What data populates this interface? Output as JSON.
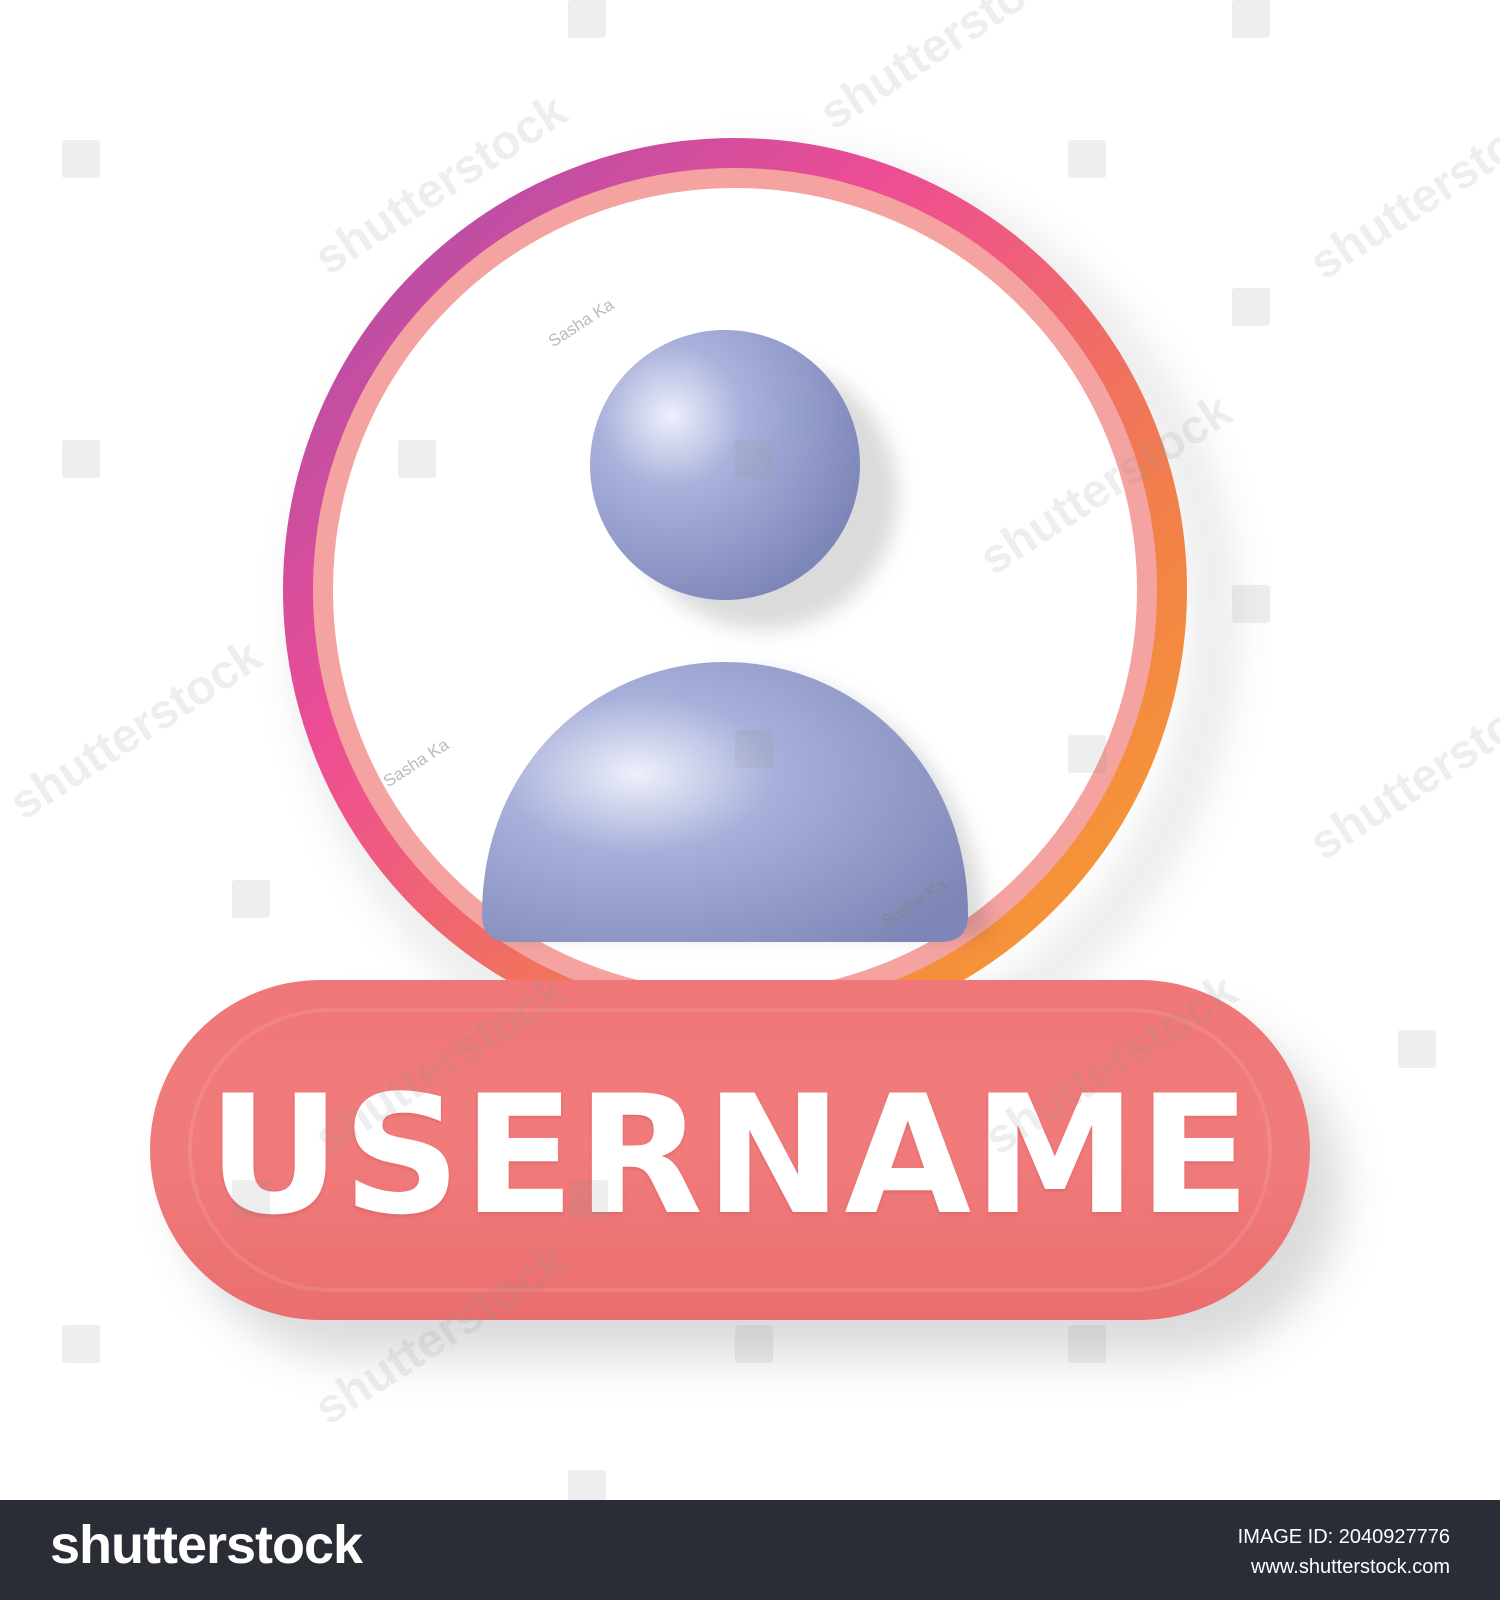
{
  "label": {
    "text": "USERNAME",
    "color": "#f17a7a"
  },
  "avatar": {
    "icon": "user-profile-icon",
    "color": "#8f98c8",
    "ring_gradient": [
      "#a853a8",
      "#ee4d94",
      "#f2804a",
      "#f79a2a"
    ],
    "ring_inner_color": "#f5a3a0"
  },
  "watermarks": {
    "brand_text": "shutterstock",
    "author_text": "Sasha Ka"
  },
  "footer": {
    "logo": "shutterstock",
    "image_id": "IMAGE ID: 2040927776",
    "url": "www.shutterstock.com"
  }
}
